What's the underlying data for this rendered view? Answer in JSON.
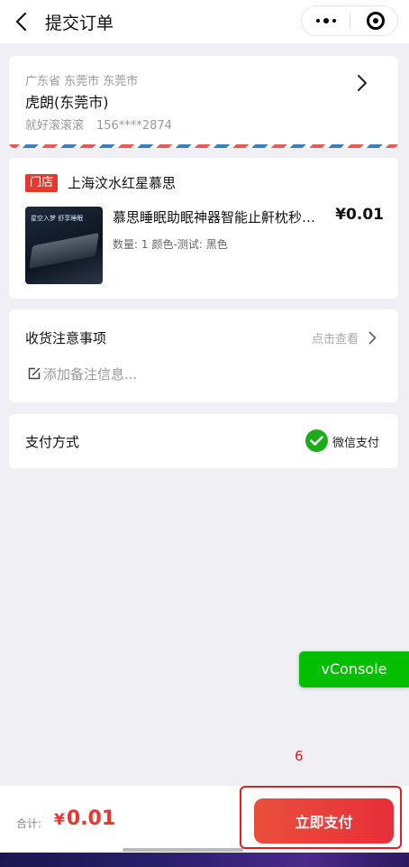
{
  "nav": {
    "title": "提交订单"
  },
  "address": {
    "region": "广东省 东莞市 东莞市",
    "name": "虎朗(东莞市)",
    "recipient": "就好滚滚滚",
    "phone": "156****2874"
  },
  "shop": {
    "badge": "门店",
    "name": "上海汶水红星慕思",
    "product": {
      "title": "慕思睡眠助眠神器智能止鼾枕秒…",
      "price": "¥0.01",
      "quantity": "数量: 1",
      "spec": "颜色-测试: 黑色",
      "thumb_text": "星空入梦  舒享睡眠"
    }
  },
  "notes": {
    "label": "收货注意事项",
    "view_label": "点击查看",
    "placeholder": "添加备注信息..."
  },
  "payment": {
    "label": "支付方式",
    "method": "微信支付",
    "method_icon": "wechat-pay-icon"
  },
  "vconsole": {
    "label": "vConsole"
  },
  "marker": {
    "number": "6"
  },
  "footer": {
    "total_label": "合计:",
    "currency": "¥",
    "total_amount": "0.01",
    "pay_button_label": "立即支付"
  },
  "colors": {
    "accent_red": "#e8372f",
    "wechat_green": "#04be02",
    "annotation_red": "#e02020"
  }
}
